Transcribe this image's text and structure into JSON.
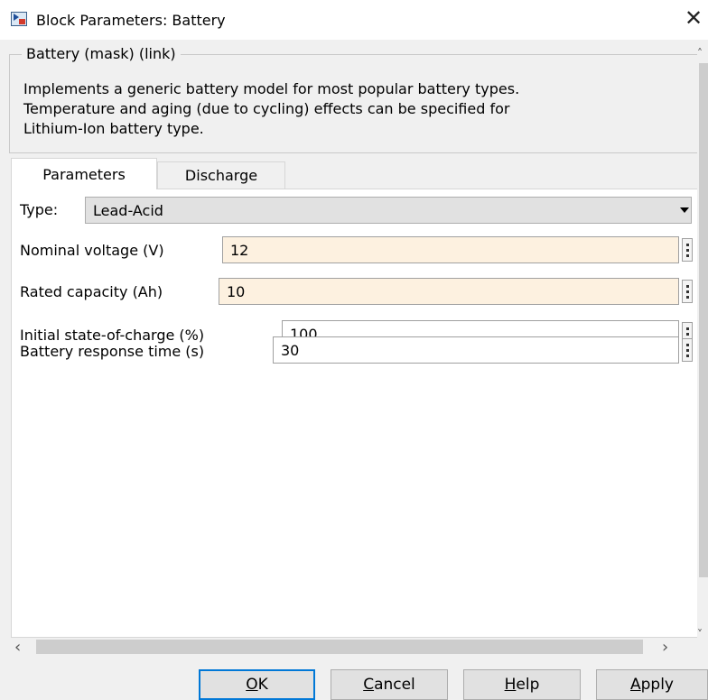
{
  "window": {
    "title": "Block Parameters: Battery",
    "icon": "simulink-block-icon"
  },
  "header": {
    "group_title": "Battery (mask) (link)",
    "description_lines": [
      "Implements a generic battery model for most popular battery types.",
      "Temperature and aging (due to cycling) effects can be specified for",
      "Lithium-Ion battery type."
    ]
  },
  "tabs": [
    {
      "label": "Parameters",
      "selected": true
    },
    {
      "label": "Discharge",
      "selected": false
    }
  ],
  "params": {
    "type": {
      "label": "Type:",
      "value": "Lead-Acid"
    },
    "nominal_voltage": {
      "label": "Nominal voltage (V)",
      "value": "12"
    },
    "rated_capacity": {
      "label": "Rated capacity (Ah)",
      "value": "10"
    },
    "initial_soc": {
      "label": "Initial state-of-charge (%)",
      "value": "100"
    },
    "response_time": {
      "label": "Battery response time (s)",
      "value": "30"
    }
  },
  "buttons": {
    "ok": {
      "mnemonic": "O",
      "rest": "K"
    },
    "cancel": {
      "mnemonic": "C",
      "rest": "ancel"
    },
    "help": {
      "mnemonic": "H",
      "rest": "elp"
    },
    "apply": {
      "mnemonic": "A",
      "rest": "pply"
    }
  },
  "colors": {
    "highlight_field": "#fdf1e0",
    "focus_border": "#0078d7"
  }
}
